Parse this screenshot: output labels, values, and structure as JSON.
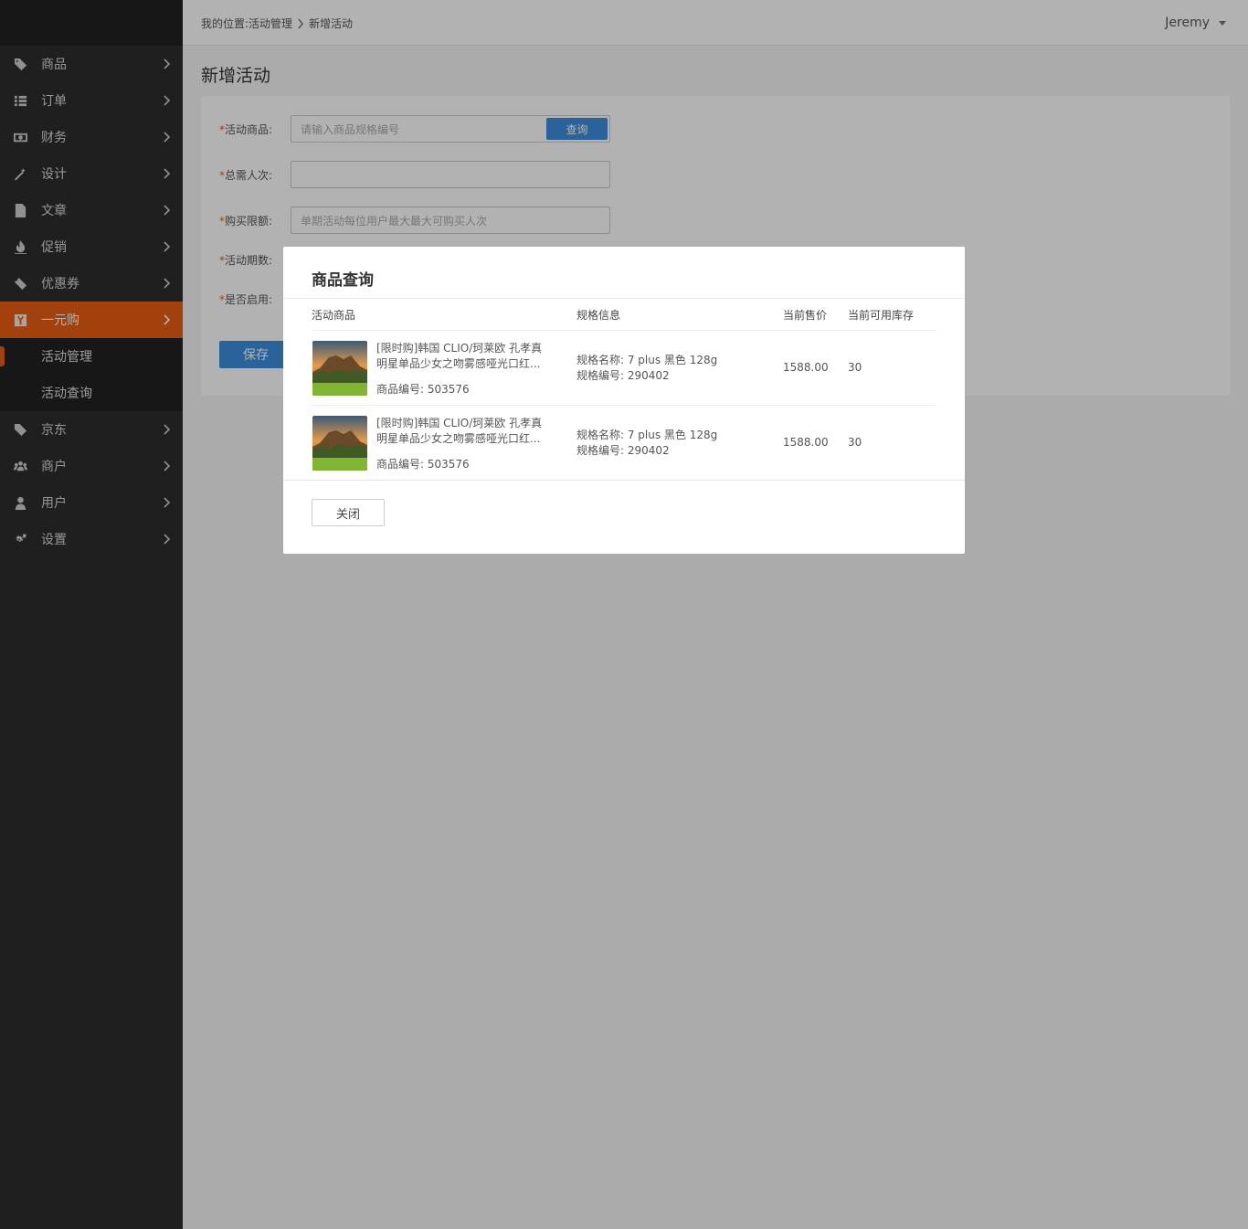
{
  "sidebar": {
    "items": [
      {
        "label": "商品",
        "icon": "tag-icon"
      },
      {
        "label": "订单",
        "icon": "list-icon"
      },
      {
        "label": "财务",
        "icon": "money-icon"
      },
      {
        "label": "设计",
        "icon": "magic-wand-icon"
      },
      {
        "label": "文章",
        "icon": "document-icon"
      },
      {
        "label": "促销",
        "icon": "fire-icon"
      },
      {
        "label": "优惠券",
        "icon": "ticket-icon"
      },
      {
        "label": "一元购",
        "icon": "yuan-icon"
      },
      {
        "label": "京东",
        "icon": "tag-icon"
      },
      {
        "label": "商户",
        "icon": "users-icon"
      },
      {
        "label": "用户",
        "icon": "user-icon"
      },
      {
        "label": "设置",
        "icon": "gears-icon"
      }
    ],
    "sub_items": [
      {
        "label": "活动管理"
      },
      {
        "label": "活动查询"
      }
    ],
    "accent_color": "#e95e13"
  },
  "topbar": {
    "breadcrumb_prefix": "我的位置:活动管理",
    "breadcrumb_current": "新增活动",
    "user_name": "Jeremy"
  },
  "main": {
    "title": "新增活动",
    "form": {
      "product_label": "活动商品:",
      "product_placeholder": "请输入商品规格编号",
      "query_label": "查询",
      "total_label": "总需人次:",
      "limit_label": "购买限额:",
      "limit_placeholder": "单期活动每位用户最大最大可购买人次",
      "period_label": "活动期数:",
      "enabled_label": "是否启用:",
      "required_mark": "*",
      "save_label": "保存"
    }
  },
  "modal": {
    "title": "商品查询",
    "columns": [
      "活动商品",
      "规格信息",
      "当前售价",
      "当前可用库存"
    ],
    "rows": [
      {
        "name_line1": "[限时购]韩国 CLIO/珂莱欧 孔孝真",
        "name_line2": "明星单品少女之吻雾感哑光口红...",
        "code": "商品编号: 503576",
        "spec_name": "规格名称:  7 plus 黑色 128g",
        "spec_code": "规格编号:  290402",
        "price": "1588.00",
        "stock": "30"
      },
      {
        "name_line1": "[限时购]韩国 CLIO/珂莱欧 孔孝真",
        "name_line2": "明星单品少女之吻雾感哑光口红...",
        "code": "商品编号: 503576",
        "spec_name": "规格名称:  7 plus 黑色 128g",
        "spec_code": "规格编号:  290402",
        "price": "1588.00",
        "stock": "30"
      }
    ],
    "close_label": "关闭"
  }
}
